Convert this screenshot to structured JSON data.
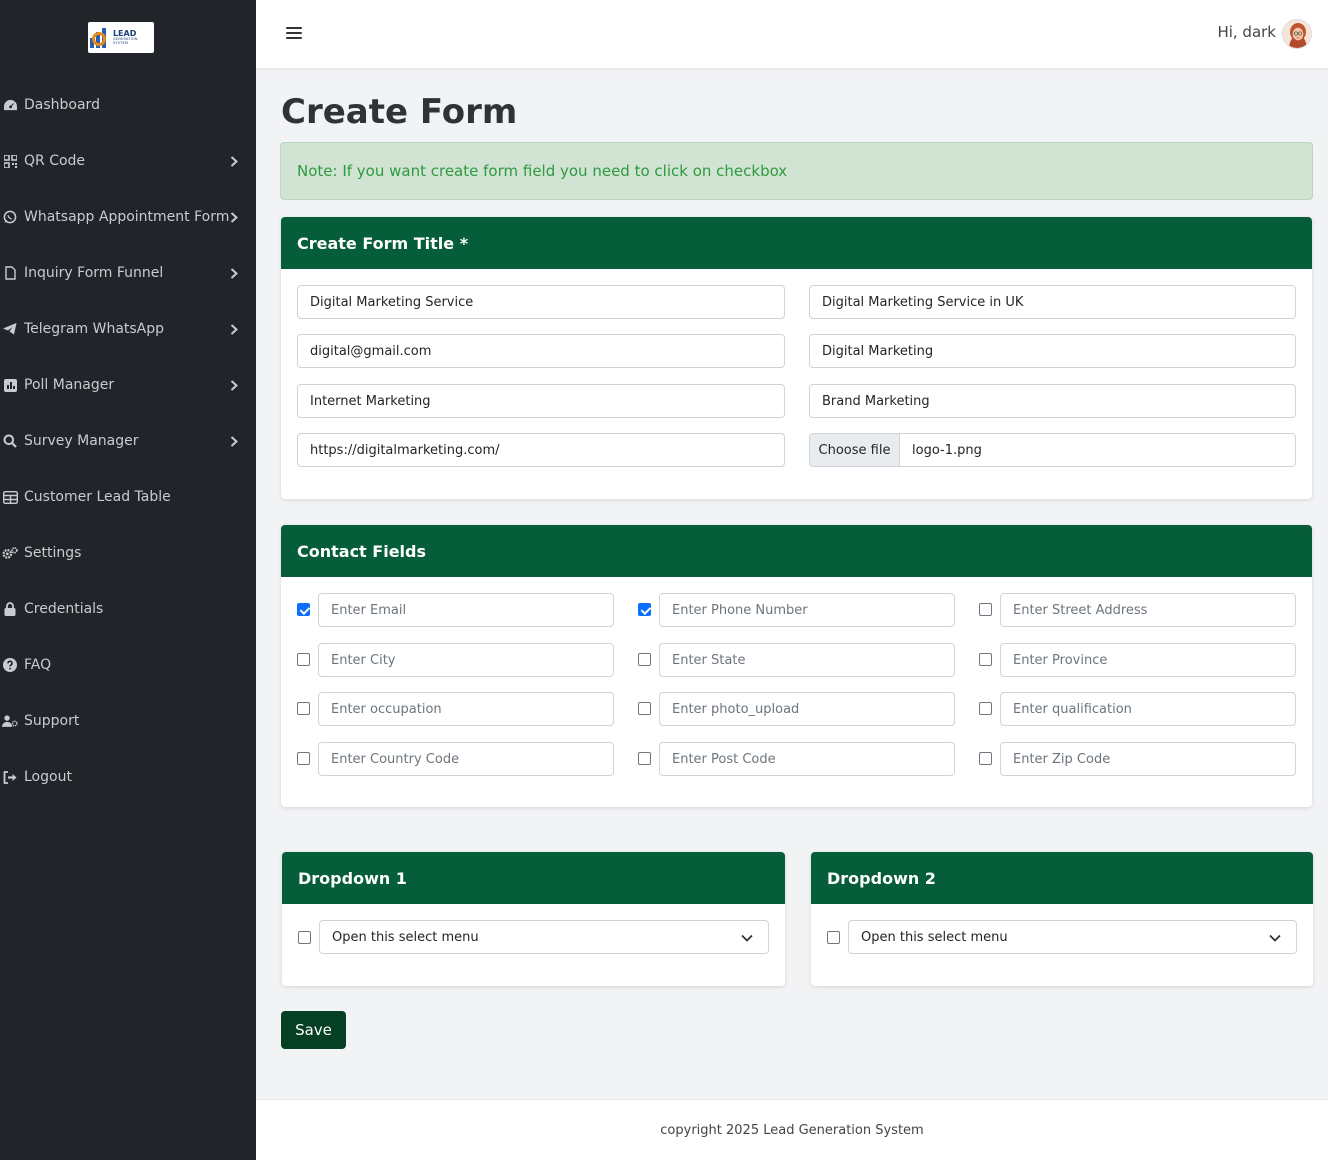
{
  "sidebar": {
    "logo": {
      "line1": "LEAD",
      "line2": "GENERATION SYSTEM"
    },
    "items": [
      {
        "label": "Dashboard",
        "icon": "dashboard-gauge-icon",
        "has_submenu": false
      },
      {
        "label": "QR Code",
        "icon": "qrcode-icon",
        "has_submenu": true
      },
      {
        "label": "Whatsapp Appointment Form",
        "icon": "whatsapp-icon",
        "has_submenu": true
      },
      {
        "label": "Inquiry Form Funnel",
        "icon": "file-icon",
        "has_submenu": true
      },
      {
        "label": "Telegram WhatsApp",
        "icon": "telegram-icon",
        "has_submenu": true
      },
      {
        "label": "Poll Manager",
        "icon": "poll-chart-icon",
        "has_submenu": true
      },
      {
        "label": "Survey Manager",
        "icon": "search-icon",
        "has_submenu": true
      },
      {
        "label": "Customer Lead Table",
        "icon": "table-icon",
        "has_submenu": false
      },
      {
        "label": "Settings",
        "icon": "gears-icon",
        "has_submenu": false
      },
      {
        "label": "Credentials",
        "icon": "lock-icon",
        "has_submenu": false
      },
      {
        "label": "FAQ",
        "icon": "question-circle-icon",
        "has_submenu": false
      },
      {
        "label": "Support",
        "icon": "user-gear-icon",
        "has_submenu": false
      },
      {
        "label": "Logout",
        "icon": "sign-out-icon",
        "has_submenu": false
      }
    ]
  },
  "topbar": {
    "greeting": "Hi, dark"
  },
  "page": {
    "title": "Create Form",
    "note": "Note: If you want create form field you need to click on checkbox"
  },
  "title_card": {
    "heading": "Create Form Title *",
    "fields": {
      "f1": "Digital Marketing Service",
      "f2": "Digital Marketing Service in UK",
      "f3": "digital@gmail.com",
      "f4": "Digital Marketing",
      "f5": "Internet Marketing",
      "f6": "Brand Marketing",
      "f7": "https://digitalmarketing.com/"
    },
    "file_button": "Choose file",
    "file_name": "logo-1.png"
  },
  "contact_card": {
    "heading": "Contact Fields",
    "fields": [
      {
        "placeholder": "Enter Email",
        "checked": true
      },
      {
        "placeholder": "Enter Phone Number",
        "checked": true
      },
      {
        "placeholder": "Enter Street Address",
        "checked": false
      },
      {
        "placeholder": "Enter City",
        "checked": false
      },
      {
        "placeholder": "Enter State",
        "checked": false
      },
      {
        "placeholder": "Enter Province",
        "checked": false
      },
      {
        "placeholder": "Enter occupation",
        "checked": false
      },
      {
        "placeholder": "Enter photo_upload",
        "checked": false
      },
      {
        "placeholder": "Enter qualification",
        "checked": false
      },
      {
        "placeholder": "Enter Country Code",
        "checked": false
      },
      {
        "placeholder": "Enter Post Code",
        "checked": false
      },
      {
        "placeholder": "Enter Zip Code",
        "checked": false
      }
    ]
  },
  "dropdown1": {
    "heading": "Dropdown 1",
    "selected": "Open this select menu",
    "checked": false
  },
  "dropdown2": {
    "heading": "Dropdown 2",
    "selected": "Open this select menu",
    "checked": false
  },
  "save_label": "Save",
  "footer": {
    "text": "copyright 2025 Lead Generation System"
  },
  "colors": {
    "sidebar_bg": "#212529",
    "card_header": "#065d3a",
    "save_button": "#053f24",
    "alert_bg": "#d1e3d3",
    "alert_text": "#2f9a3e",
    "checkbox_checked": "#0d6efd"
  }
}
